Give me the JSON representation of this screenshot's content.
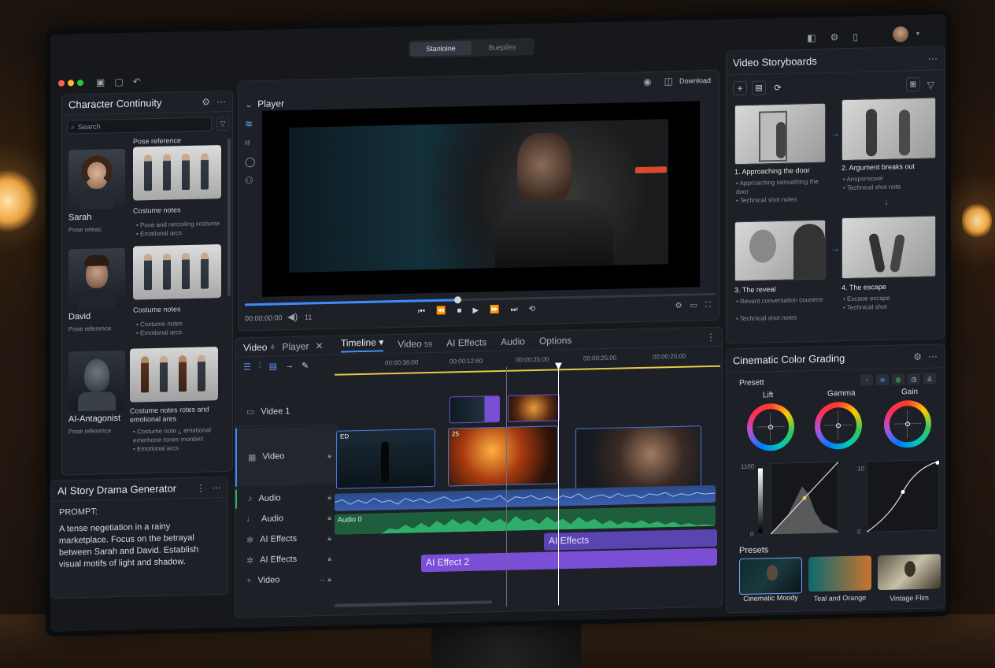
{
  "top_bar": {
    "toggle": [
      "Stanloine",
      "Buepiles"
    ],
    "download": "Download"
  },
  "character_continuity": {
    "title": "Character Continuity",
    "search_placeholder": "Search",
    "pose_reference_header": "Pose reference",
    "characters": [
      {
        "name": "Sarah",
        "sub": "Pose releac",
        "notes_title": "Costume notes",
        "notes": [
          "Pose and rercoiling costume",
          "Emational arcs"
        ]
      },
      {
        "name": "David",
        "sub": "Pose reference",
        "notes_title": "Costume notes",
        "notes": [
          "Costume notes",
          "Emotional arcs"
        ]
      },
      {
        "name": "AI-Antagonist",
        "sub": "Pose reference",
        "notes_title": "Costume notes rotes and emotional ares",
        "notes": [
          "Costume note ¿ emational",
          "emerhone rones rnonbes",
          "Emotional arcs"
        ]
      }
    ]
  },
  "story_generator": {
    "title": "AI Story Drama Generator",
    "prompt_label": "PROMPT:",
    "prompt_text": "A tense negetiation in a rainy marketplace. Focus on the betrayal between Sarah and David. Establish visual motifs of light and shadow."
  },
  "player": {
    "title": "Player",
    "time": "00:00:00:00",
    "volume": "11"
  },
  "timeline": {
    "left_tabs": [
      {
        "label": "Video",
        "badge": "4"
      },
      {
        "label": "Player",
        "badge": ""
      }
    ],
    "tabs": [
      {
        "label": "Timeline"
      },
      {
        "label": "Video",
        "badge": "59"
      },
      {
        "label": "AI Effects"
      },
      {
        "label": "Audio"
      },
      {
        "label": "Options"
      }
    ],
    "ruler": [
      "00:00:36:00",
      "00:00:12:60",
      "00:00:25:00",
      "00:00:25:00",
      "00:00:25:00"
    ],
    "tracks": [
      "Videe 1",
      "Video",
      "Audio",
      "Audio",
      "AI Effects",
      "AI Effects",
      "Video"
    ],
    "clips": {
      "audio2_label": "Audio 0",
      "effect1": "AI Effects",
      "effect2": "AI Effect 2",
      "clip_tag1": "ED",
      "clip_tag2": "25"
    }
  },
  "storyboards": {
    "title": "Video Storyboards",
    "frames": [
      {
        "title": "1. Approaching the door",
        "notes": [
          "Approaching tamoathing the door",
          "Technical shot notes"
        ]
      },
      {
        "title": "2. Argument breaks out",
        "notes": [
          "Anspsrnioxel",
          "Technical shot note"
        ]
      },
      {
        "title": "3. The reveal",
        "notes": [
          "Revant conversation counece",
          "Technical shot notes"
        ]
      },
      {
        "title": "4. The escape",
        "notes": [
          "Excaoe escape",
          "Technical shot"
        ]
      }
    ]
  },
  "color_grading": {
    "title": "Cinematic Color Grading",
    "presets_label": "Presett",
    "wheels": [
      "Lift",
      "Gamma",
      "Gain"
    ],
    "curve1": {
      "max": "1100",
      "min": "0"
    },
    "curve2": {
      "max": "10",
      "min": "0"
    },
    "presets_title": "Presets",
    "presets": [
      "Cinematic Moody",
      "Teal and Orange",
      "Vintage Flim"
    ]
  },
  "colors": {
    "accent": "#3d8bff",
    "effect": "#7a4fd6",
    "audio_blue": "#4a79d6",
    "audio_green": "#2fae6a",
    "playhead": "#e8c84a"
  }
}
